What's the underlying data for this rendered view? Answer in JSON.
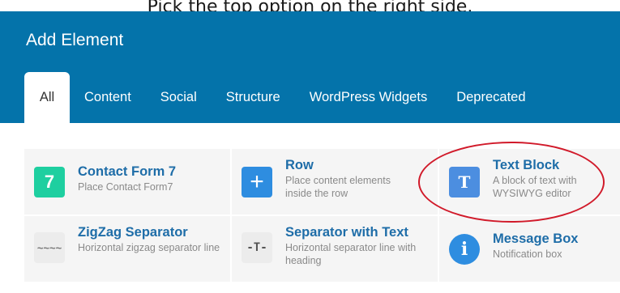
{
  "caption": {
    "text": "Pick the top option on the right side."
  },
  "header": {
    "title": "Add Element"
  },
  "tabs": [
    {
      "label": "All",
      "active": true
    },
    {
      "label": "Content"
    },
    {
      "label": "Social"
    },
    {
      "label": "Structure"
    },
    {
      "label": "WordPress Widgets"
    },
    {
      "label": "Deprecated"
    }
  ],
  "elements": [
    {
      "title": "Contact Form 7",
      "desc": "Place Contact Form7",
      "icon": "contact-form-7-icon",
      "glyph": "7",
      "color": "#1ecfa0"
    },
    {
      "title": "Row",
      "desc": "Place content elements inside the row",
      "icon": "plus-icon",
      "glyph": "+",
      "color": "#2e8de0"
    },
    {
      "title": "Text Block",
      "desc": "A block of text with WYSIWYG editor",
      "icon": "text-t-icon",
      "glyph": "T",
      "color": "#4c8ee0"
    },
    {
      "title": "ZigZag Separator",
      "desc": "Horizontal zigzag separator line",
      "icon": "zigzag-icon",
      "glyph": "~~~~",
      "color": "#ececec"
    },
    {
      "title": "Separator with Text",
      "desc": "Horizontal separator line with heading",
      "icon": "separator-text-icon",
      "glyph": "-T-",
      "color": "#ececec"
    },
    {
      "title": "Message Box",
      "desc": "Notification box",
      "icon": "info-icon",
      "glyph": "i",
      "color": "#2e8de0"
    }
  ],
  "annotation": {
    "color": "#d11a2a"
  },
  "colors": {
    "header_bg": "#0473aa",
    "title_blue": "#1e6da8"
  }
}
